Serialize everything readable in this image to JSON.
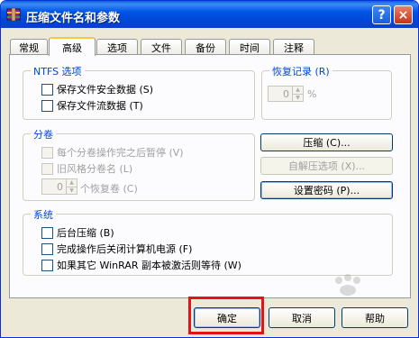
{
  "window": {
    "title": "压缩文件名和参数",
    "help_btn": "?",
    "close_btn": "×"
  },
  "tabs": [
    {
      "label": "常规",
      "active": false
    },
    {
      "label": "高级",
      "active": true
    },
    {
      "label": "选项",
      "active": false
    },
    {
      "label": "文件",
      "active": false
    },
    {
      "label": "备份",
      "active": false
    },
    {
      "label": "时间",
      "active": false
    },
    {
      "label": "注释",
      "active": false
    }
  ],
  "ntfs": {
    "title": "NTFS 选项",
    "opt1": "保存文件安全数据 (S)",
    "opt2": "保存文件流数据 (T)"
  },
  "recovery": {
    "title": "恢复记录 (R)",
    "value": "0",
    "unit": "%"
  },
  "volumes": {
    "title": "分卷",
    "opt1": "每个分卷操作完之后暂停 (V)",
    "opt2": "旧风格分卷名 (L)",
    "spin_value": "0",
    "spin_label": "个恢复卷 (C)"
  },
  "side_buttons": {
    "compress": "压缩 (C)...",
    "sfx": "自解压选项 (X)...",
    "password": "设置密码 (P)..."
  },
  "system": {
    "title": "系统",
    "opt1": "后台压缩 (B)",
    "opt2": "完成操作后关闭计算机电源 (F)",
    "opt3": "如果其它 WinRAR 副本被激活则等待 (W)"
  },
  "footer": {
    "ok": "确定",
    "cancel": "取消",
    "help": "帮助"
  },
  "colors": {
    "titlebar": "#0055e5",
    "group_title": "#0046d5",
    "highlight": "#e2141b"
  }
}
